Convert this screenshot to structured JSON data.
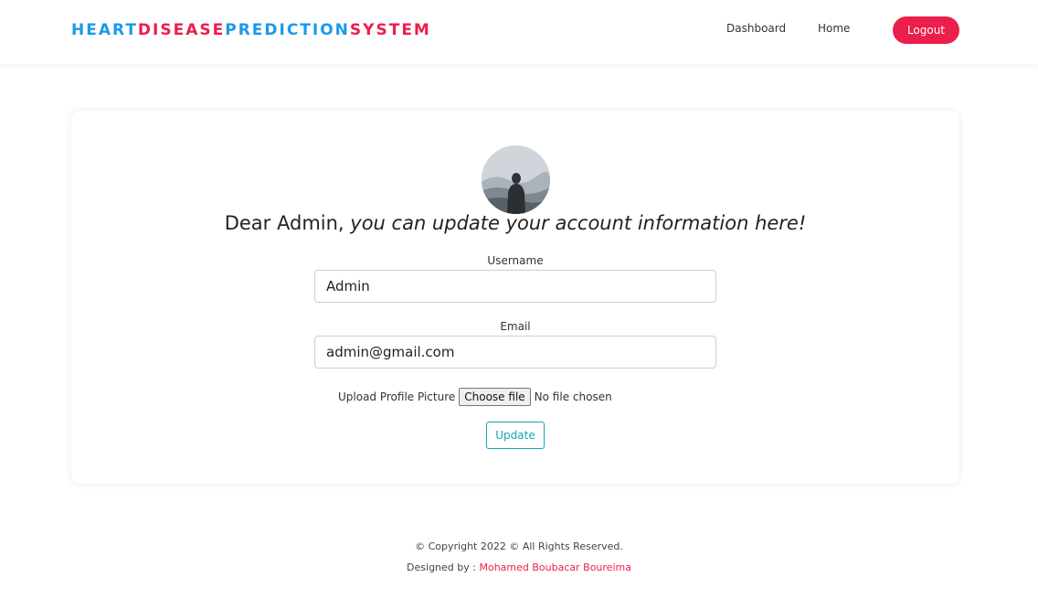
{
  "header": {
    "brand": {
      "part1": "HEART",
      "part2": "DISEASE",
      "part3": "PREDICTION",
      "part4": "SYSTEM"
    },
    "nav": {
      "dashboard": "Dashboard",
      "home": "Home"
    },
    "logout_label": "Logout"
  },
  "profile": {
    "greeting": "Dear Admin, ",
    "message": "you can update your account information here!",
    "username_label": "Username",
    "username_value": "Admin",
    "email_label": "Email",
    "email_value": "admin@gmail.com",
    "upload_label": "Upload Profile Picture",
    "choose_file_label": "Choose file",
    "no_file_text": "No file chosen",
    "update_label": "Update"
  },
  "footer": {
    "copyright": "© Copyright 2022 © All Rights Reserved.",
    "designed_by": "Designed by : ",
    "designer_name": "Mohamed Boubacar Boureima"
  },
  "colors": {
    "brand_blue": "#1a9ae8",
    "brand_red": "#ec1e4b",
    "update_accent": "#17a2b8"
  }
}
